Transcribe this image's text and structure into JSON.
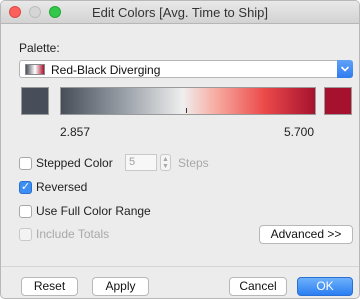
{
  "window": {
    "title": "Edit Colors [Avg. Time to Ship]"
  },
  "palette": {
    "label": "Palette:",
    "selected": "Red-Black Diverging",
    "start_color": "#474e59",
    "end_color": "#a6122e",
    "range_min": "2.857",
    "range_max": "5.700"
  },
  "options": {
    "stepped_color": {
      "label": "Stepped Color",
      "checked": false
    },
    "steps": {
      "value": "5",
      "label": "Steps",
      "enabled": false
    },
    "reversed": {
      "label": "Reversed",
      "checked": true
    },
    "use_full_range": {
      "label": "Use Full Color Range",
      "checked": false
    },
    "include_totals": {
      "label": "Include Totals",
      "checked": false,
      "enabled": false
    }
  },
  "buttons": {
    "advanced": "Advanced >>",
    "reset": "Reset",
    "apply": "Apply",
    "cancel": "Cancel",
    "ok": "OK"
  },
  "colors": {
    "accent": "#3b8ef3"
  }
}
